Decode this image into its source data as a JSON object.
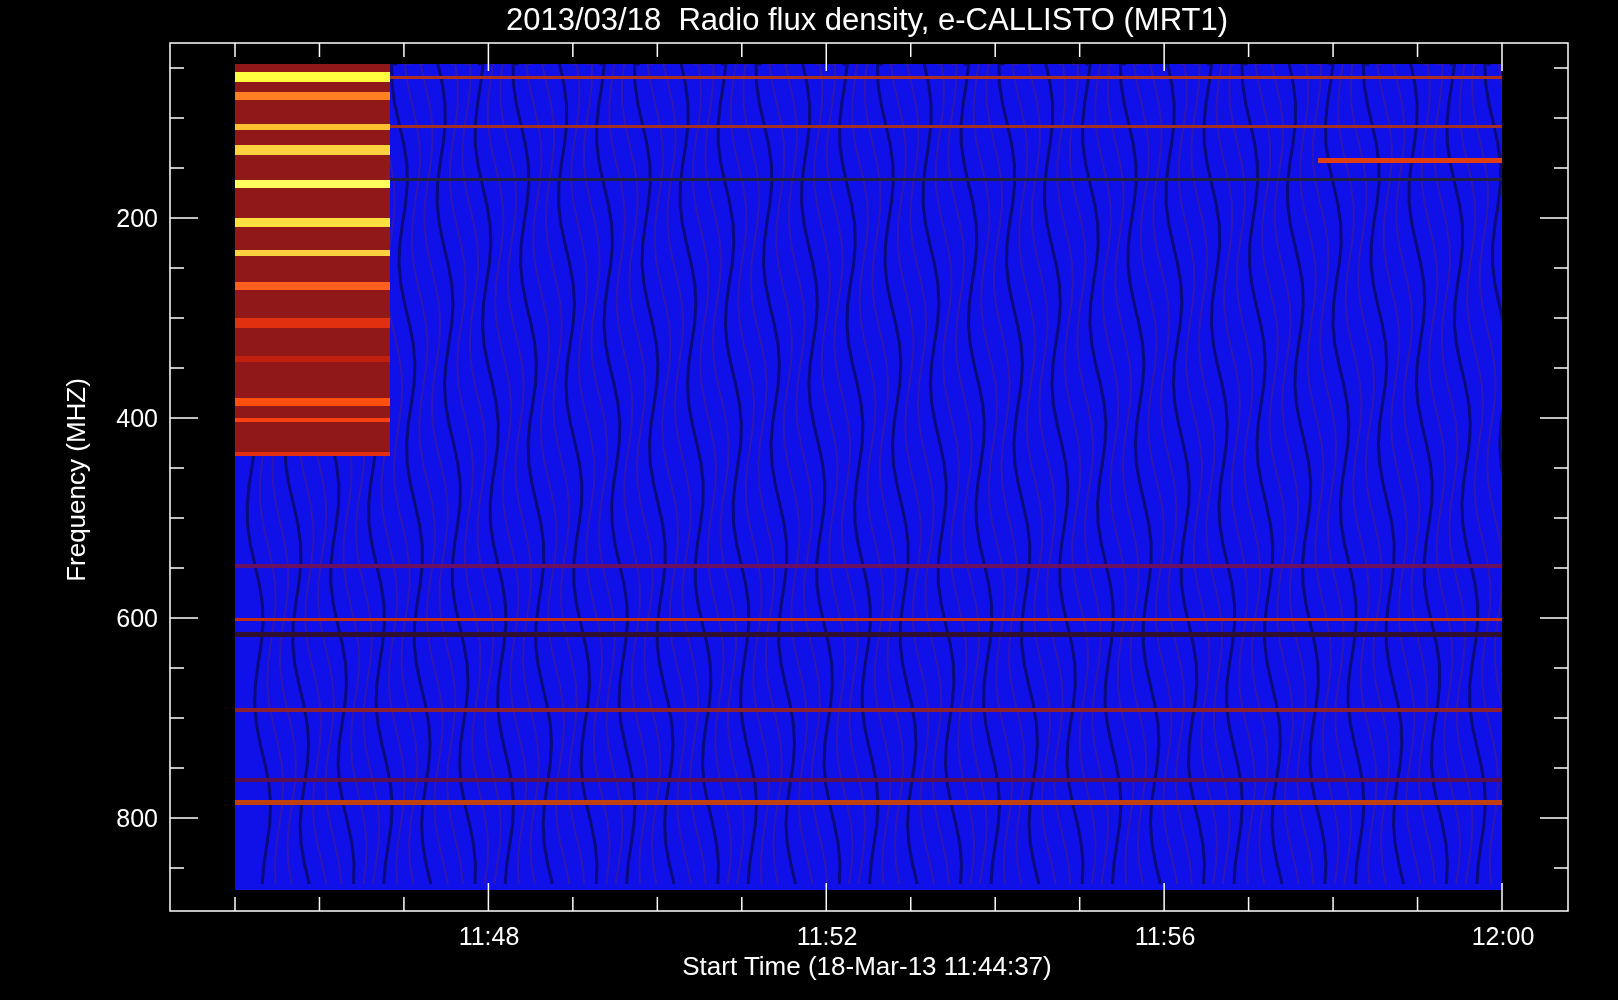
{
  "title": "2013/03/18  Radio flux density, e-CALLISTO (MRT1)",
  "y_axis": {
    "label": "Frequency (MHZ)",
    "ticks": [
      "200",
      "400",
      "600",
      "800"
    ]
  },
  "x_axis": {
    "label": "Start Time (18-Mar-13 11:44:37)",
    "ticks": [
      "11:48",
      "11:52",
      "11:56",
      "12:00"
    ]
  }
}
